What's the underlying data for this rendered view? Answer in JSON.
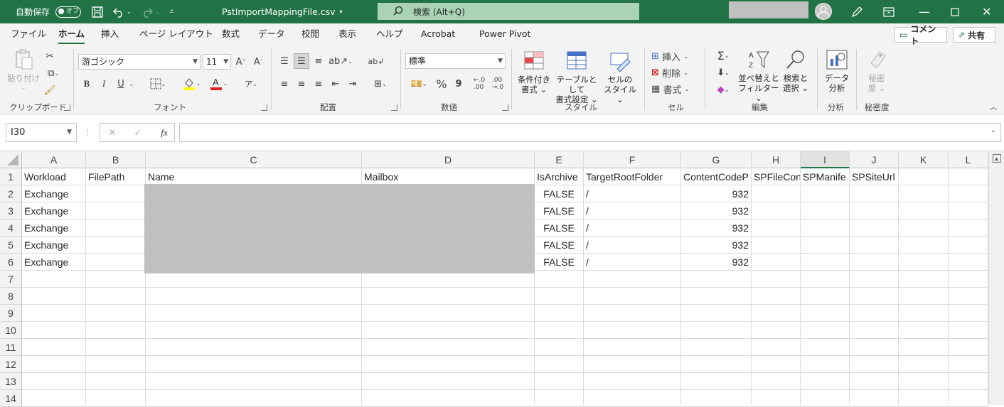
{
  "titlebar": {
    "autosave_label": "自動保存",
    "autosave_state": "オフ",
    "filename": "PstImportMappingFile.csv",
    "search_placeholder": "検索 (Alt+Q)"
  },
  "tabs": [
    "ファイル",
    "ホーム",
    "挿入",
    "ページ レイアウト",
    "数式",
    "データ",
    "校閲",
    "表示",
    "ヘルプ",
    "Acrobat",
    "Power Pivot"
  ],
  "active_tab": "ホーム",
  "top_buttons": {
    "comment": "コメント",
    "share": "共有"
  },
  "ribbon": {
    "clipboard": {
      "paste": "貼り付け",
      "label": "クリップボード"
    },
    "font": {
      "name": "游ゴシック",
      "size": "11",
      "label": "フォント",
      "bold": "B",
      "italic": "I",
      "underline": "U"
    },
    "alignment": {
      "label": "配置"
    },
    "number": {
      "format": "標準",
      "percent": "%",
      "comma": "9",
      "label": "数値"
    },
    "styles": {
      "conditional": [
        "条件付き",
        "書式"
      ],
      "table": [
        "テーブルとして",
        "書式設定"
      ],
      "cell": [
        "セルの",
        "スタイル"
      ],
      "label": "スタイル"
    },
    "cells": {
      "insert": "挿入",
      "delete": "削除",
      "format": "書式",
      "label": "セル"
    },
    "editing": {
      "sort": [
        "並べ替えと",
        "フィルター"
      ],
      "find": [
        "検索と",
        "選択"
      ],
      "label": "編集"
    },
    "analysis": {
      "data": [
        "データ",
        "分析"
      ],
      "label": "分析"
    },
    "sensitivity": {
      "btn": [
        "秘密",
        "度"
      ],
      "label": "秘密度"
    }
  },
  "formula_bar": {
    "name_box": "I30",
    "fx": "fx",
    "cancel": "✕",
    "enter": "✓",
    "formula": ""
  },
  "grid": {
    "columns": [
      "A",
      "B",
      "C",
      "D",
      "E",
      "F",
      "G",
      "H",
      "I",
      "J",
      "K",
      "L"
    ],
    "selected_column": "I",
    "rows": [
      "1",
      "2",
      "3",
      "4",
      "5",
      "6",
      "7",
      "8",
      "9",
      "10",
      "11",
      "12",
      "13",
      "14"
    ],
    "header_row": [
      "Workload",
      "FilePath",
      "Name",
      "Mailbox",
      "IsArchive",
      "TargetRootFolder",
      "ContentCodeP",
      "SPFileCon",
      "SPManife",
      "SPSiteUrl",
      "",
      ""
    ],
    "data_rows": [
      [
        "Exchange",
        "",
        "",
        "",
        "FALSE",
        "/",
        "932",
        "",
        "",
        "",
        "",
        ""
      ],
      [
        "Exchange",
        "",
        "",
        "",
        "FALSE",
        "/",
        "932",
        "",
        "",
        "",
        "",
        ""
      ],
      [
        "Exchange",
        "",
        "",
        "",
        "FALSE",
        "/",
        "932",
        "",
        "",
        "",
        "",
        ""
      ],
      [
        "Exchange",
        "",
        "",
        "",
        "FALSE",
        "/",
        "932",
        "",
        "",
        "",
        "",
        ""
      ],
      [
        "Exchange",
        "",
        "",
        "",
        "FALSE",
        "/",
        "932",
        "",
        "",
        "",
        "",
        ""
      ]
    ]
  }
}
